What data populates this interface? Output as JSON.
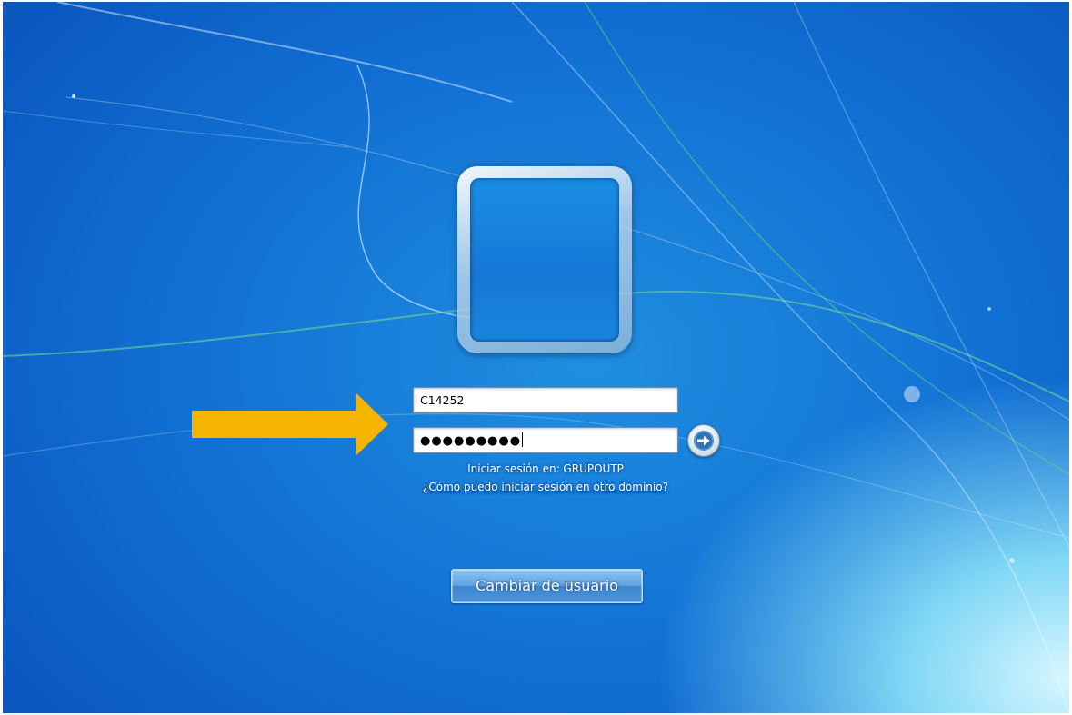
{
  "login": {
    "username_value": "C14252",
    "password_masked": "●●●●●●●●●",
    "domain_text": "Iniciar sesión en: GRUPOUTP",
    "domain_link": "¿Cómo puedo iniciar sesión en otro dominio?",
    "switch_user_label": "Cambiar de usuario",
    "submit_icon": "arrow-right-icon"
  },
  "annotation": {
    "arrow_color": "#F5B400",
    "arrow_icon": "pointer-arrow-icon"
  },
  "colors": {
    "background": "#1170D3",
    "button": "#4C95D9"
  }
}
